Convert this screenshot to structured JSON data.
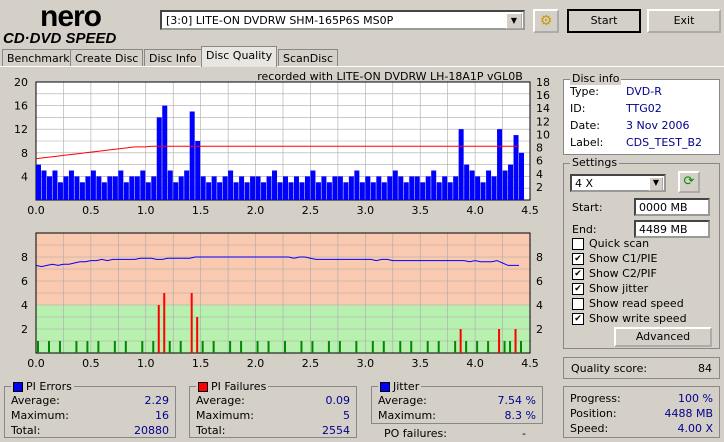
{
  "app": {
    "logo_top": "nero",
    "logo_bottom": "CD·DVD SPEED"
  },
  "toolbar": {
    "drive": "[3:0]  LITE-ON DVDRW SHM-165P6S MS0P",
    "start": "Start",
    "exit": "Exit"
  },
  "tabs": [
    "Benchmark",
    "Create Disc",
    "Disc Info",
    "Disc Quality",
    "ScanDisc"
  ],
  "recorded_with": "recorded with LITE-ON DVDRW LH-18A1P   vGL0B",
  "disc_info": {
    "title": "Disc info",
    "rows": [
      {
        "label": "Type:",
        "value": "DVD-R"
      },
      {
        "label": "ID:",
        "value": "TTG02"
      },
      {
        "label": "Date:",
        "value": "3 Nov 2006"
      },
      {
        "label": "Label:",
        "value": "CDS_TEST_B2"
      }
    ]
  },
  "settings": {
    "title": "Settings",
    "speed": "4 X",
    "start_label": "Start:",
    "start_value": "0000 MB",
    "end_label": "End:",
    "end_value": "4489 MB",
    "checks": [
      {
        "label": "Quick scan",
        "checked": false
      },
      {
        "label": "Show C1/PIE",
        "checked": true
      },
      {
        "label": "Show C2/PIF",
        "checked": true
      },
      {
        "label": "Show jitter",
        "checked": true
      },
      {
        "label": "Show read speed",
        "checked": false
      },
      {
        "label": "Show write speed",
        "checked": true
      }
    ],
    "advanced": "Advanced"
  },
  "quality": {
    "label": "Quality score:",
    "value": "84"
  },
  "progress": [
    {
      "label": "Progress:",
      "value": "100 %"
    },
    {
      "label": "Position:",
      "value": "4488 MB"
    },
    {
      "label": "Speed:",
      "value": "4.00 X"
    }
  ],
  "pi_errors": {
    "title": "PI Errors",
    "color": "#0000ff",
    "rows": [
      {
        "label": "Average:",
        "value": "2.29"
      },
      {
        "label": "Maximum:",
        "value": "16"
      },
      {
        "label": "Total:",
        "value": "20880"
      }
    ]
  },
  "pi_failures": {
    "title": "PI Failures",
    "color": "#ff0000",
    "rows": [
      {
        "label": "Average:",
        "value": "0.09"
      },
      {
        "label": "Maximum:",
        "value": "5"
      },
      {
        "label": "Total:",
        "value": "2554"
      }
    ]
  },
  "jitter": {
    "title": "Jitter",
    "color": "#0000ff",
    "rows": [
      {
        "label": "Average:",
        "value": "7.54 %"
      },
      {
        "label": "Maximum:",
        "value": "8.3 %"
      }
    ]
  },
  "po_failures": {
    "label": "PO failures:",
    "value": "-"
  },
  "chart_data": [
    {
      "type": "bar",
      "title": "PI Errors / write speed",
      "x_ticks": [
        "0.0",
        "0.5",
        "1.0",
        "1.5",
        "2.0",
        "2.5",
        "3.0",
        "3.5",
        "4.0",
        "4.5"
      ],
      "xlim": [
        0,
        4.5
      ],
      "ylim": [
        0,
        20
      ],
      "y_ticks": [
        "4",
        "8",
        "12",
        "16",
        "20"
      ],
      "y2lim": [
        0,
        18
      ],
      "y2_ticks": [
        "2",
        "4",
        "6",
        "8",
        "10",
        "12",
        "14",
        "16",
        "18"
      ],
      "x_step": 0.05,
      "pi_errors": [
        6,
        5,
        4,
        5,
        3,
        4,
        5,
        4,
        3,
        4,
        5,
        4,
        3,
        4,
        4,
        5,
        3,
        4,
        4,
        5,
        3,
        4,
        14,
        16,
        5,
        3,
        4,
        5,
        15,
        10,
        4,
        3,
        4,
        3,
        4,
        5,
        3,
        4,
        3,
        4,
        4,
        3,
        4,
        5,
        3,
        4,
        3,
        4,
        3,
        4,
        5,
        3,
        4,
        3,
        4,
        4,
        3,
        4,
        5,
        3,
        4,
        3,
        4,
        3,
        4,
        5,
        4,
        3,
        4,
        4,
        3,
        4,
        5,
        3,
        4,
        3,
        4,
        12,
        6,
        5,
        4,
        3,
        5,
        4,
        12,
        5,
        6,
        11,
        8
      ],
      "write_speed": [
        6.3,
        6.4,
        6.5,
        6.6,
        6.7,
        6.8,
        6.9,
        7.0,
        7.1,
        7.2,
        7.3,
        7.4,
        7.5,
        7.6,
        7.7,
        7.8,
        7.9,
        8.0,
        8.1,
        8.1,
        8.1,
        8.2,
        8.2,
        8.2,
        8.2,
        8.2,
        8.2,
        8.2,
        8.2,
        8.2,
        8.2,
        8.2,
        8.2,
        8.2,
        8.2,
        8.2,
        8.2,
        8.2,
        8.2,
        8.2,
        8.2,
        8.2,
        8.2,
        8.2,
        8.2,
        8.2,
        8.2,
        8.2,
        8.2,
        8.2,
        8.2,
        8.2,
        8.2,
        8.2,
        8.2,
        8.2,
        8.2,
        8.2,
        8.2,
        8.2,
        8.2,
        8.2,
        8.2,
        8.2,
        8.2,
        8.2,
        8.2,
        8.2,
        8.2,
        8.2,
        8.2,
        8.2,
        8.2,
        8.2,
        8.2,
        8.2,
        8.2,
        8.2,
        8.2,
        8.2,
        8.2,
        8.2,
        8.2,
        8.2,
        8.2,
        8.2,
        8.2,
        8.2,
        8.2
      ]
    },
    {
      "type": "bar",
      "title": "PI Failures / jitter",
      "x_ticks": [
        "0.0",
        "0.5",
        "1.0",
        "1.5",
        "2.0",
        "2.5",
        "3.0",
        "3.5",
        "4.0",
        "4.5"
      ],
      "xlim": [
        0,
        4.5
      ],
      "ylim": [
        0,
        10
      ],
      "y_ticks": [
        "2",
        "4",
        "6",
        "8"
      ],
      "y2_ticks": [
        "2",
        "4",
        "6",
        "8"
      ],
      "x_step": 0.05,
      "pi_failures": [
        1,
        0,
        1,
        0,
        1,
        0,
        0,
        1,
        0,
        1,
        0,
        1,
        0,
        0,
        1,
        0,
        1,
        0,
        0,
        1,
        0,
        1,
        4,
        5,
        1,
        0,
        1,
        0,
        5,
        3,
        1,
        0,
        1,
        0,
        0,
        1,
        0,
        1,
        0,
        0,
        1,
        0,
        1,
        0,
        0,
        1,
        0,
        0,
        1,
        0,
        1,
        0,
        0,
        1,
        0,
        1,
        0,
        0,
        1,
        0,
        0,
        1,
        0,
        1,
        0,
        0,
        1,
        0,
        1,
        0,
        0,
        1,
        0,
        1,
        0,
        0,
        1,
        2,
        1,
        0,
        1,
        0,
        1,
        0,
        2,
        1,
        1,
        2,
        1
      ],
      "jitter": [
        7.3,
        7.2,
        7.3,
        7.4,
        7.3,
        7.4,
        7.4,
        7.5,
        7.6,
        7.6,
        7.7,
        7.7,
        7.8,
        7.7,
        7.8,
        7.8,
        7.8,
        7.8,
        7.8,
        7.9,
        7.9,
        7.9,
        7.8,
        7.8,
        7.9,
        7.9,
        7.9,
        7.9,
        7.9,
        8.0,
        8.0,
        8.0,
        8.0,
        8.0,
        8.0,
        8.0,
        8.0,
        8.0,
        8.0,
        8.0,
        8.0,
        8.0,
        8.0,
        8.0,
        8.0,
        8.0,
        8.0,
        7.9,
        8.0,
        8.0,
        7.9,
        7.8,
        7.8,
        7.8,
        7.8,
        7.8,
        7.8,
        7.8,
        7.8,
        7.8,
        7.8,
        7.8,
        7.7,
        7.8,
        7.8,
        7.7,
        7.7,
        7.7,
        7.7,
        7.7,
        7.7,
        7.7,
        7.7,
        7.7,
        7.7,
        7.7,
        7.7,
        7.7,
        7.7,
        7.6,
        7.7,
        7.6,
        7.6,
        7.6,
        7.7,
        7.5,
        7.3,
        7.3,
        7.3
      ]
    }
  ]
}
